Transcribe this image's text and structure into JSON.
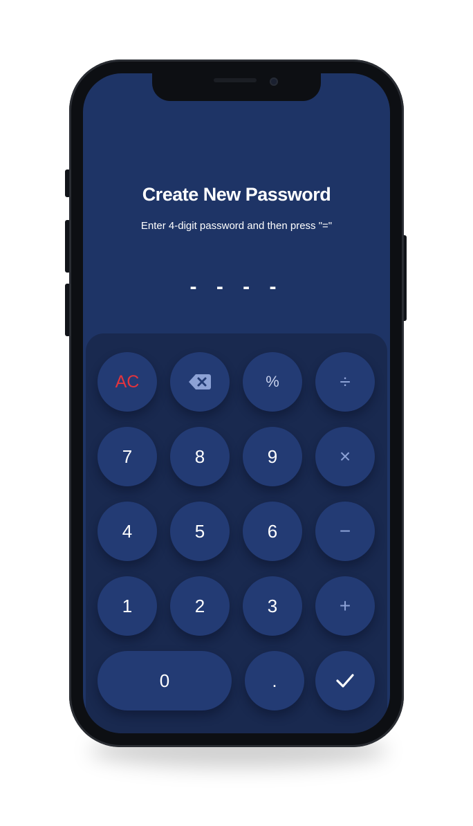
{
  "screen": {
    "title": "Create New Password",
    "subtitle": "Enter 4-digit password and then press \"=\"",
    "password_placeholder": "- - - -"
  },
  "keypad": {
    "rows": [
      [
        {
          "name": "ac-button",
          "label": "AC",
          "kind": "ac"
        },
        {
          "name": "backspace-button",
          "icon": "backspace-icon",
          "kind": "icon"
        },
        {
          "name": "percent-button",
          "label": "%",
          "kind": "pct"
        },
        {
          "name": "divide-button",
          "label": "÷",
          "kind": "op"
        }
      ],
      [
        {
          "name": "key-7",
          "label": "7"
        },
        {
          "name": "key-8",
          "label": "8"
        },
        {
          "name": "key-9",
          "label": "9"
        },
        {
          "name": "multiply-button",
          "label": "×",
          "kind": "op"
        }
      ],
      [
        {
          "name": "key-4",
          "label": "4"
        },
        {
          "name": "key-5",
          "label": "5"
        },
        {
          "name": "key-6",
          "label": "6"
        },
        {
          "name": "minus-button",
          "label": "−",
          "kind": "op"
        }
      ],
      [
        {
          "name": "key-1",
          "label": "1"
        },
        {
          "name": "key-2",
          "label": "2"
        },
        {
          "name": "key-3",
          "label": "3"
        },
        {
          "name": "plus-button",
          "label": "+",
          "kind": "op"
        }
      ],
      [
        {
          "name": "key-0",
          "label": "0",
          "kind": "wide"
        },
        {
          "name": "decimal-button",
          "label": "."
        },
        {
          "name": "confirm-button",
          "icon": "check-icon",
          "kind": "icon"
        }
      ]
    ]
  },
  "colors": {
    "screen_bg": "#1e3466",
    "keypad_bg": "#19294f",
    "key_bg": "#233b74",
    "accent_red": "#e2343e",
    "operator": "#8da2d6"
  }
}
